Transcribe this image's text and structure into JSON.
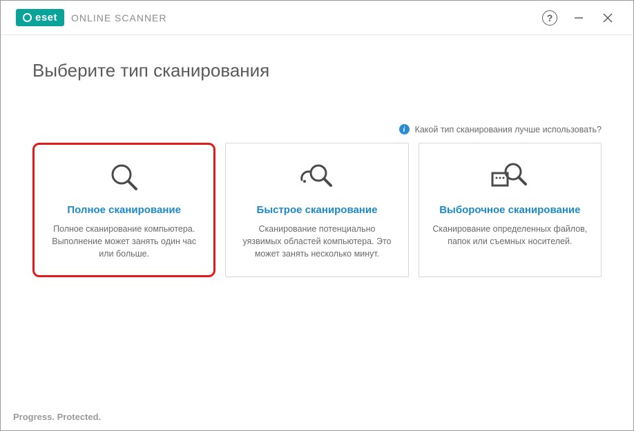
{
  "header": {
    "brand": "eset",
    "product": "ONLINE SCANNER"
  },
  "page": {
    "title": "Выберите тип сканирования",
    "info_hint": "Какой тип сканирования лучше использовать?"
  },
  "cards": {
    "full": {
      "title": "Полное сканирование",
      "desc": "Полное сканирование компьютера. Выполнение может занять один час или больше."
    },
    "quick": {
      "title": "Быстрое сканирование",
      "desc": "Сканирование потенциально уязвимых областей компьютера. Это может занять несколько минут."
    },
    "custom": {
      "title": "Выборочное сканирование",
      "desc": "Сканирование определенных файлов, папок или съемных носителей."
    }
  },
  "footer": {
    "tagline": "Progress. Protected."
  }
}
